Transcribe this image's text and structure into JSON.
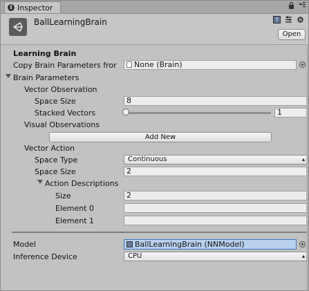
{
  "tab": {
    "label": "Inspector"
  },
  "header": {
    "object_name": "BallLearningBrain",
    "open_label": "Open"
  },
  "section": {
    "title": "Learning Brain"
  },
  "copy_brain": {
    "label": "Copy Brain Parameters fror",
    "value": "None (Brain)"
  },
  "brain_params": {
    "label": "Brain Parameters",
    "vector_observation": {
      "label": "Vector Observation",
      "space_size_label": "Space Size",
      "space_size_value": "8",
      "stacked_label": "Stacked Vectors",
      "stacked_value": "1",
      "stacked_slider_fraction": 0
    },
    "visual_observations": {
      "label": "Visual Observations",
      "add_new": "Add New"
    },
    "vector_action": {
      "label": "Vector Action",
      "space_type_label": "Space Type",
      "space_type_value": "Continuous",
      "space_size_label": "Space Size",
      "space_size_value": "2",
      "action_desc_label": "Action Descriptions",
      "size_label": "Size",
      "size_value": "2",
      "elements": [
        {
          "label": "Element 0",
          "value": ""
        },
        {
          "label": "Element 1",
          "value": ""
        }
      ]
    }
  },
  "model": {
    "label": "Model",
    "value": "BallLearningBrain (NNModel)"
  },
  "inference": {
    "label": "Inference Device",
    "value": "CPU"
  },
  "colors": {
    "background": "#c2c2c2",
    "selection": "#b9d1ee",
    "selection_border": "#3d79c4"
  },
  "icons": [
    "info-icon",
    "lock-icon",
    "menu-icon",
    "unity-logo-icon",
    "help-icon",
    "preset-icon",
    "settings-icon",
    "object-picker-icon",
    "foldout-arrow-icon"
  ]
}
